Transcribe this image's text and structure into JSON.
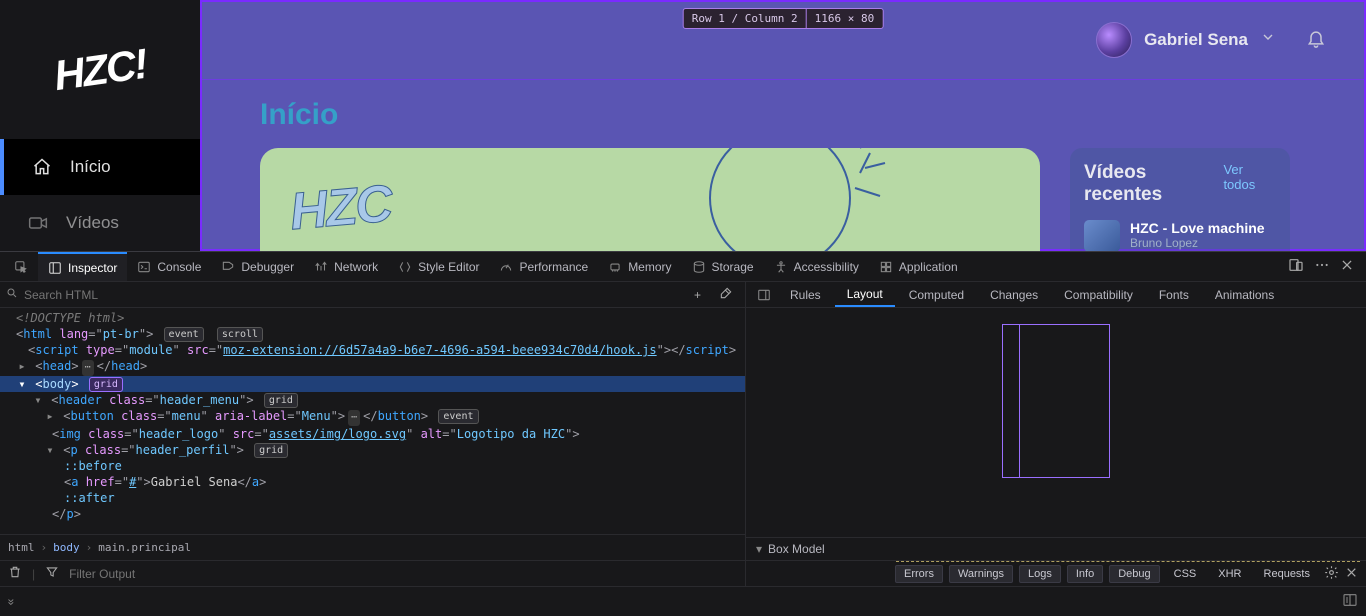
{
  "app": {
    "logo_alt": "HZC!",
    "nav": [
      {
        "label": "Início",
        "icon": "home",
        "active": true
      },
      {
        "label": "Vídeos",
        "icon": "video",
        "active": false
      }
    ],
    "grid_tag": {
      "cell": "Row 1 / Column 2",
      "dims": "1166 × 80"
    },
    "user_name": "Gabriel Sena",
    "page_title": "Início",
    "recent": {
      "title": "Vídeos recentes",
      "see_all": "Ver todos",
      "item_title": "HZC - Love machine",
      "item_author": "Bruno Lopez"
    }
  },
  "devtools": {
    "tabs": [
      "Inspector",
      "Console",
      "Debugger",
      "Network",
      "Style Editor",
      "Performance",
      "Memory",
      "Storage",
      "Accessibility",
      "Application"
    ],
    "active_tab": "Inspector",
    "search_placeholder": "Search HTML",
    "subtabs": [
      "Rules",
      "Layout",
      "Computed",
      "Changes",
      "Compatibility",
      "Fonts",
      "Animations"
    ],
    "active_subtab": "Layout",
    "box_model_label": "Box Model",
    "crumbs": [
      "html",
      "body",
      "main.principal"
    ],
    "filter_placeholder": "Filter Output",
    "pills": {
      "errors": "Errors",
      "warnings": "Warnings",
      "logs": "Logs",
      "info": "Info",
      "debug": "Debug",
      "css": "CSS",
      "xhr": "XHR",
      "requests": "Requests"
    },
    "dom": {
      "doctype": "<!DOCTYPE html>",
      "html_lang": "pt-br",
      "badges": {
        "event": "event",
        "scroll": "scroll",
        "grid": "grid"
      },
      "script_type": "module",
      "script_src": "moz-extension://6d57a4a9-b6e7-4696-a594-beee934c70d4/hook.js",
      "head": "head",
      "body": "body",
      "header_class": "header_menu",
      "button_class": "menu",
      "button_aria": "Menu",
      "img_class": "header_logo",
      "img_src": "assets/img/logo.svg",
      "img_alt": "Logotipo da HZC",
      "p_class": "header_perfil",
      "before": "::before",
      "a_href": "#",
      "a_text": "Gabriel Sena",
      "after": "::after"
    }
  }
}
